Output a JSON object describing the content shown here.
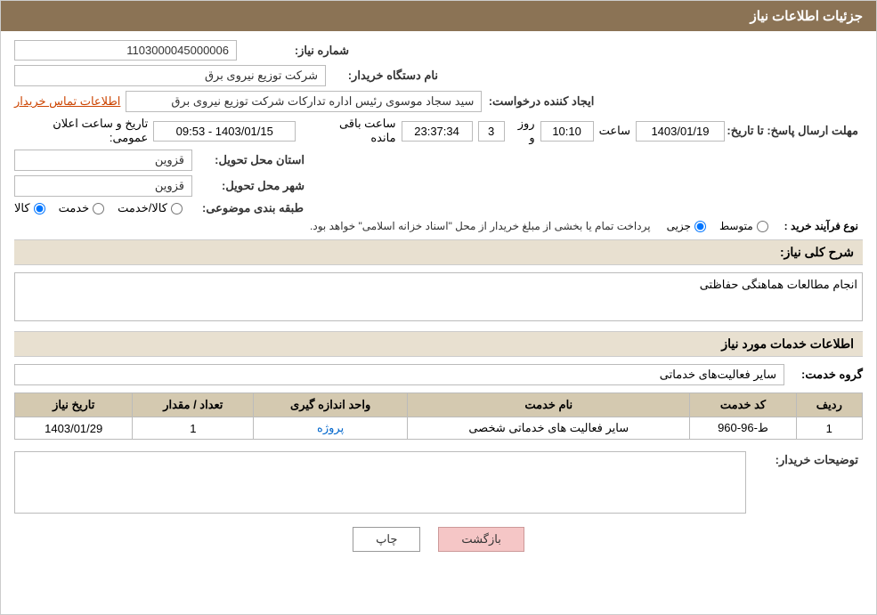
{
  "header": {
    "title": "جزئیات اطلاعات نیاز"
  },
  "info": {
    "shomara_label": "شماره نیاز:",
    "shomara_value": "1103000045000006",
    "name_darkhast_label": "نام دستگاه خریدار:",
    "name_darkhast_value": "شرکت توزیع نیروی برق",
    "ijad_label": "ایجاد کننده درخواست:",
    "ijad_value": "سید سجاد موسوی رئیس اداره تداركات شرکت توزیع نیروی برق",
    "contact_link": "اطلاعات تماس خریدار",
    "mohlat_label": "مهلت ارسال پاسخ: تا تاریخ:",
    "date_value": "1403/01/19",
    "saat_label": "ساعت",
    "saat_value": "10:10",
    "rooz_label": "روز و",
    "rooz_value": "3",
    "baghimande_label": "ساعت باقی مانده",
    "baghimande_value": "23:37:34",
    "tarikh_elan_label": "تاریخ و ساعت اعلان عمومی:",
    "tarikh_elan_value": "1403/01/15 - 09:53",
    "ostan_label": "استان محل تحویل:",
    "ostan_value": "قزوین",
    "shahr_label": "شهر محل تحویل:",
    "shahr_value": "قزوین",
    "tabaqe_label": "طبقه بندی موضوعی:",
    "radio_kala": "کالا",
    "radio_khedmat": "خدمت",
    "radio_kala_khedmat": "کالا/خدمت",
    "nooe_label": "نوع فرآیند خرید :",
    "nooe_jozee": "جزیی",
    "nooe_motavasset": "متوسط",
    "nooe_desc": "پرداخت تمام یا بخشی از مبلغ خریدار از محل \"اسناد خزانه اسلامی\" خواهد بود."
  },
  "sharh_label": "شرح کلی نیاز:",
  "sharh_value": "انجام مطالعات هماهنگی حفاظتی",
  "services_section": {
    "title": "اطلاعات خدمات مورد نیاز",
    "group_label": "گروه خدمت:",
    "group_value": "سایر فعالیت‌های خدماتی",
    "table": {
      "headers": [
        "ردیف",
        "کد خدمت",
        "نام خدمت",
        "واحد اندازه گیری",
        "تعداد / مقدار",
        "تاریخ نیاز"
      ],
      "rows": [
        {
          "radif": "1",
          "kod": "ط-96-960",
          "name": "سایر فعالیت های خدماتی شخصی",
          "vahed": "پروژه",
          "tedad": "1",
          "tarikh": "1403/01/29"
        }
      ]
    }
  },
  "buyer_desc_label": "توضیحات خریدار:",
  "buttons": {
    "print": "چاپ",
    "back": "بازگشت"
  }
}
